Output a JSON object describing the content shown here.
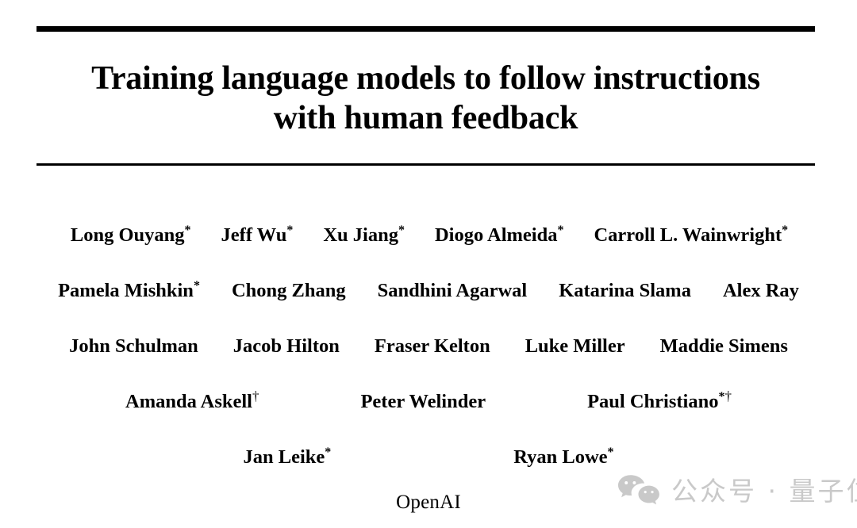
{
  "document": {
    "type": "academic-paper-title-page",
    "title_lines": [
      "Training language models to follow instructions",
      "with human feedback"
    ],
    "affiliation": "OpenAI",
    "author_rows": [
      {
        "authors": [
          {
            "name": "Long Ouyang",
            "mark": "*"
          },
          {
            "name": "Jeff Wu",
            "mark": "*"
          },
          {
            "name": "Xu Jiang",
            "mark": "*"
          },
          {
            "name": "Diogo Almeida",
            "mark": "*"
          },
          {
            "name": "Carroll L. Wainwright",
            "mark": "*"
          }
        ]
      },
      {
        "authors": [
          {
            "name": "Pamela Mishkin",
            "mark": "*"
          },
          {
            "name": "Chong Zhang",
            "mark": ""
          },
          {
            "name": "Sandhini Agarwal",
            "mark": ""
          },
          {
            "name": "Katarina Slama",
            "mark": ""
          },
          {
            "name": "Alex Ray",
            "mark": ""
          }
        ]
      },
      {
        "authors": [
          {
            "name": "John Schulman",
            "mark": ""
          },
          {
            "name": "Jacob Hilton",
            "mark": ""
          },
          {
            "name": "Fraser Kelton",
            "mark": ""
          },
          {
            "name": "Luke Miller",
            "mark": ""
          },
          {
            "name": "Maddie Simens",
            "mark": ""
          }
        ]
      },
      {
        "authors": [
          {
            "name": "Amanda Askell",
            "mark": "",
            "dagger": "†"
          },
          {
            "name": "Peter Welinder",
            "mark": ""
          },
          {
            "name": "Paul Christiano",
            "mark": "*",
            "dagger": "†"
          }
        ]
      },
      {
        "authors": [
          {
            "name": "Jan Leike",
            "mark": "*"
          },
          {
            "name": "Ryan Lowe",
            "mark": "*"
          }
        ]
      }
    ]
  },
  "watermark": {
    "icon": "wechat-icon",
    "text": "公众号 · 量子位",
    "color": "#c9c9c9"
  },
  "colors": {
    "background": "#ffffff",
    "text": "#000000",
    "rule": "#000000",
    "watermark": "#c9c9c9"
  }
}
